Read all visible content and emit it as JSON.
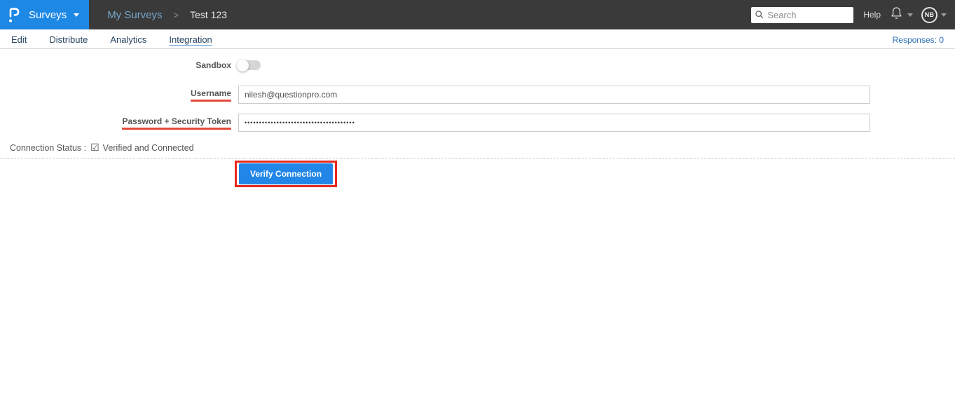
{
  "brand": {
    "logo_name": "questionpro-logo",
    "product_label": "Surveys",
    "accent_color": "#1e88e5"
  },
  "breadcrumb": {
    "parent": "My Surveys",
    "separator": ">",
    "current": "Test 123"
  },
  "topbar": {
    "search_placeholder": "Search",
    "help_label": "Help",
    "avatar_initials": "NB"
  },
  "tabs": {
    "items": [
      {
        "label": "Edit",
        "active": false
      },
      {
        "label": "Distribute",
        "active": false
      },
      {
        "label": "Analytics",
        "active": false
      },
      {
        "label": "Integration",
        "active": true
      }
    ],
    "responses_label": "Responses: 0"
  },
  "form": {
    "sandbox_label": "Sandbox",
    "sandbox_enabled": false,
    "username_label": "Username",
    "username_value": "nilesh@questionpro.com",
    "password_label": "Password + Security Token",
    "password_masked": "••••••••••••••••••••••••••••••••••••••",
    "connection_status_label": "Connection Status :",
    "connection_status_check": "☑",
    "connection_status_value": "Verified and Connected",
    "verify_button_label": "Verify Connection"
  },
  "colors": {
    "brand_blue": "#1e88e5",
    "navbar_dark": "#3a3a3a",
    "button_blue": "#2186e8",
    "annotation_red": "#e8291f",
    "label_underline_red": "#e6493a",
    "responses_blue": "#2a6fb5"
  }
}
